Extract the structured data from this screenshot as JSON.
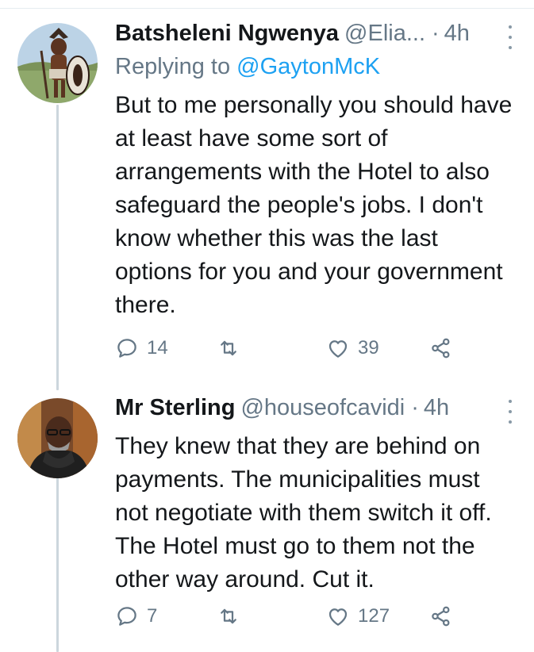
{
  "tweets": [
    {
      "name": "Batsheleni Ngwenya",
      "handle": "@Elia...",
      "dot": "·",
      "time": "4h",
      "reply_prefix": "Replying to ",
      "reply_mention": "@GaytonMcK",
      "text": "But to me personally you should have at least have some sort of arrangements with the Hotel to also safeguard the people's jobs. I don't know whether this was the last options for you and your government there.",
      "replies": "14",
      "likes": "39"
    },
    {
      "name": "Mr Sterling",
      "handle": "@houseofcavidi",
      "dot": "·",
      "time": "4h",
      "text": "They knew that they are behind on payments. The municipalities must not negotiate with them switch it off. The Hotel must go to them not the other way around. Cut it.",
      "replies": "7",
      "likes": "127"
    }
  ],
  "icons": {
    "reply": "reply-icon",
    "retweet": "retweet-icon",
    "like": "like-icon",
    "share": "share-icon",
    "more": "more-options-icon"
  },
  "colors": {
    "text": "#14171a",
    "secondary": "#657786",
    "link": "#1da1f2",
    "thread_line": "#ccd6dd"
  }
}
